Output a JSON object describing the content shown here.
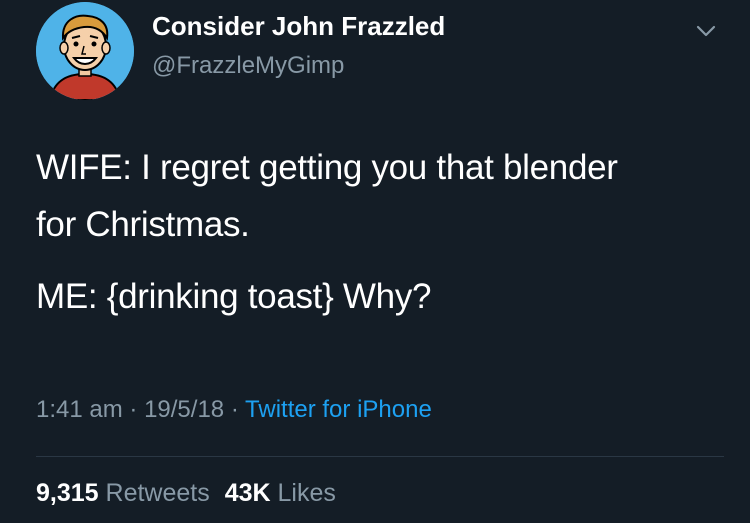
{
  "author": {
    "display_name": "Consider John Frazzled",
    "handle": "@FrazzleMyGimp",
    "avatar_icon": "cartoon-man-avatar-icon"
  },
  "menu": {
    "caret_icon": "chevron-down-icon"
  },
  "tweet": {
    "lines": [
      "WIFE: I regret getting you that blender",
      "for Christmas.",
      "ME: {drinking toast} Why?"
    ]
  },
  "meta": {
    "time": "1:41 am",
    "separator": "·",
    "date": "19/5/18",
    "source": "Twitter for iPhone"
  },
  "stats": {
    "retweets_count": "9,315",
    "retweets_label": "Retweets",
    "likes_count": "43K",
    "likes_label": "Likes"
  },
  "colors": {
    "background": "#141d26",
    "secondary_text": "#8899a6",
    "link": "#1da1f2",
    "avatar_bg": "#4fb3e8"
  }
}
